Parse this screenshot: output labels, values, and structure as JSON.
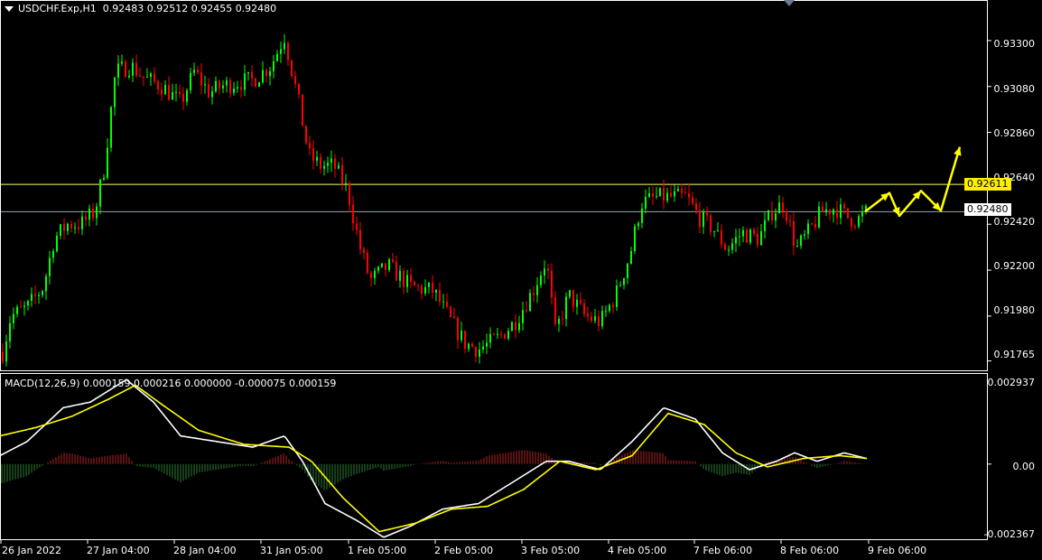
{
  "header": {
    "symbol": "USDCHF.Exp,H1",
    "ohlc": "0.92483 0.92512 0.92455 0.92480"
  },
  "price_axis": {
    "labels": [
      "0.93300",
      "0.93080",
      "0.92860",
      "0.92640",
      "0.92420",
      "0.92200",
      "0.91980",
      "0.91765"
    ]
  },
  "price_boxes": {
    "horizontal_level": "0.92611",
    "current_price": "0.92480"
  },
  "macd": {
    "title": "MACD(12,26,9) 0.000159 0.000216 0.000000 -0.000075 0.000159",
    "axis_labels": [
      "0.002937",
      "0.00",
      "-0.002367"
    ]
  },
  "time_axis": {
    "labels": [
      "26 Jan 2022",
      "27 Jan 04:00",
      "28 Jan 04:00",
      "31 Jan 05:00",
      "1 Feb 05:00",
      "2 Feb 05:00",
      "3 Feb 05:00",
      "4 Feb 05:00",
      "7 Feb 06:00",
      "8 Feb 06:00",
      "9 Feb 06:00"
    ]
  },
  "colors": {
    "background": "#000000",
    "bull_candle": "#00ff00",
    "bear_candle": "#ff0000",
    "macd_line": "#ffffff",
    "signal_line": "#ffff00",
    "hist_positive": "#b22222",
    "hist_negative": "#2e7d32",
    "level_line": "#ffff66",
    "current_line": "#9aa3b5",
    "arrow": "#ffff00"
  },
  "chart_data": {
    "type": "candlestick",
    "ylim": [
      0.9172,
      0.9349
    ],
    "horizontal_line": 0.92611,
    "current_price": 0.9248,
    "price_path": [
      {
        "x": 0,
        "y": 0.9175
      },
      {
        "x": 12,
        "y": 0.9198
      },
      {
        "x": 30,
        "y": 0.9202
      },
      {
        "x": 48,
        "y": 0.9212
      },
      {
        "x": 60,
        "y": 0.9235
      },
      {
        "x": 75,
        "y": 0.9242
      },
      {
        "x": 90,
        "y": 0.9242
      },
      {
        "x": 105,
        "y": 0.9248
      },
      {
        "x": 115,
        "y": 0.9268
      },
      {
        "x": 128,
        "y": 0.9315
      },
      {
        "x": 145,
        "y": 0.9318
      },
      {
        "x": 160,
        "y": 0.9312
      },
      {
        "x": 180,
        "y": 0.9308
      },
      {
        "x": 200,
        "y": 0.93
      },
      {
        "x": 215,
        "y": 0.9315
      },
      {
        "x": 232,
        "y": 0.9305
      },
      {
        "x": 245,
        "y": 0.9308
      },
      {
        "x": 262,
        "y": 0.931
      },
      {
        "x": 280,
        "y": 0.9311
      },
      {
        "x": 300,
        "y": 0.9318
      },
      {
        "x": 315,
        "y": 0.9332
      },
      {
        "x": 330,
        "y": 0.9302
      },
      {
        "x": 342,
        "y": 0.9275
      },
      {
        "x": 355,
        "y": 0.927
      },
      {
        "x": 370,
        "y": 0.927
      },
      {
        "x": 385,
        "y": 0.9258
      },
      {
        "x": 398,
        "y": 0.9232
      },
      {
        "x": 410,
        "y": 0.9215
      },
      {
        "x": 430,
        "y": 0.9222
      },
      {
        "x": 455,
        "y": 0.9212
      },
      {
        "x": 480,
        "y": 0.921
      },
      {
        "x": 500,
        "y": 0.9195
      },
      {
        "x": 515,
        "y": 0.9185
      },
      {
        "x": 530,
        "y": 0.9182
      },
      {
        "x": 550,
        "y": 0.9187
      },
      {
        "x": 570,
        "y": 0.9195
      },
      {
        "x": 590,
        "y": 0.921
      },
      {
        "x": 605,
        "y": 0.9225
      },
      {
        "x": 615,
        "y": 0.919
      },
      {
        "x": 630,
        "y": 0.9208
      },
      {
        "x": 648,
        "y": 0.9198
      },
      {
        "x": 665,
        "y": 0.9195
      },
      {
        "x": 682,
        "y": 0.9208
      },
      {
        "x": 698,
        "y": 0.9228
      },
      {
        "x": 710,
        "y": 0.9252
      },
      {
        "x": 728,
        "y": 0.9255
      },
      {
        "x": 745,
        "y": 0.9255
      },
      {
        "x": 760,
        "y": 0.9255
      },
      {
        "x": 775,
        "y": 0.9245
      },
      {
        "x": 790,
        "y": 0.924
      },
      {
        "x": 805,
        "y": 0.923
      },
      {
        "x": 822,
        "y": 0.9238
      },
      {
        "x": 840,
        "y": 0.9235
      },
      {
        "x": 855,
        "y": 0.9248
      },
      {
        "x": 868,
        "y": 0.9252
      },
      {
        "x": 882,
        "y": 0.923
      },
      {
        "x": 895,
        "y": 0.9238
      },
      {
        "x": 910,
        "y": 0.9248
      },
      {
        "x": 925,
        "y": 0.925
      },
      {
        "x": 940,
        "y": 0.9245
      },
      {
        "x": 950,
        "y": 0.9244
      },
      {
        "x": 960,
        "y": 0.9248
      }
    ],
    "arrows_path": [
      {
        "x": 958,
        "y": 0.9248
      },
      {
        "x": 985,
        "y": 0.9257
      },
      {
        "x": 996,
        "y": 0.9246
      },
      {
        "x": 1020,
        "y": 0.9258
      },
      {
        "x": 1042,
        "y": 0.92485
      },
      {
        "x": 1063,
        "y": 0.9279
      }
    ],
    "macd_ylim": [
      -0.0027,
      0.0032
    ],
    "macd_main": [
      {
        "x": 0,
        "y": 0.0003
      },
      {
        "x": 30,
        "y": 0.0008
      },
      {
        "x": 70,
        "y": 0.002
      },
      {
        "x": 100,
        "y": 0.0022
      },
      {
        "x": 140,
        "y": 0.003
      },
      {
        "x": 170,
        "y": 0.0022
      },
      {
        "x": 200,
        "y": 0.001
      },
      {
        "x": 240,
        "y": 0.0008
      },
      {
        "x": 280,
        "y": 0.0006
      },
      {
        "x": 315,
        "y": 0.001
      },
      {
        "x": 335,
        "y": 0.0001
      },
      {
        "x": 360,
        "y": -0.0014
      },
      {
        "x": 395,
        "y": -0.002
      },
      {
        "x": 425,
        "y": -0.0026
      },
      {
        "x": 455,
        "y": -0.0022
      },
      {
        "x": 490,
        "y": -0.0016
      },
      {
        "x": 530,
        "y": -0.0014
      },
      {
        "x": 570,
        "y": -0.0006
      },
      {
        "x": 605,
        "y": 0.0001
      },
      {
        "x": 630,
        "y": 0.0001
      },
      {
        "x": 665,
        "y": -0.0002
      },
      {
        "x": 700,
        "y": 0.0008
      },
      {
        "x": 735,
        "y": 0.002
      },
      {
        "x": 770,
        "y": 0.0016
      },
      {
        "x": 800,
        "y": 0.0004
      },
      {
        "x": 830,
        "y": -0.0002
      },
      {
        "x": 860,
        "y": 0.0001
      },
      {
        "x": 880,
        "y": 0.0004
      },
      {
        "x": 905,
        "y": 0.0001
      },
      {
        "x": 935,
        "y": 0.0004
      },
      {
        "x": 960,
        "y": 0.0002
      }
    ],
    "macd_signal": [
      {
        "x": 0,
        "y": 0.001
      },
      {
        "x": 40,
        "y": 0.0013
      },
      {
        "x": 80,
        "y": 0.0017
      },
      {
        "x": 120,
        "y": 0.0023
      },
      {
        "x": 150,
        "y": 0.0028
      },
      {
        "x": 180,
        "y": 0.0021
      },
      {
        "x": 220,
        "y": 0.0012
      },
      {
        "x": 270,
        "y": 0.0007
      },
      {
        "x": 320,
        "y": 0.0006
      },
      {
        "x": 345,
        "y": 0.0001
      },
      {
        "x": 380,
        "y": -0.0012
      },
      {
        "x": 420,
        "y": -0.0024
      },
      {
        "x": 460,
        "y": -0.0021
      },
      {
        "x": 500,
        "y": -0.0016
      },
      {
        "x": 540,
        "y": -0.0015
      },
      {
        "x": 580,
        "y": -0.0009
      },
      {
        "x": 620,
        "y": 0.0001
      },
      {
        "x": 660,
        "y": -0.0002
      },
      {
        "x": 700,
        "y": 0.0003
      },
      {
        "x": 740,
        "y": 0.0018
      },
      {
        "x": 780,
        "y": 0.0014
      },
      {
        "x": 815,
        "y": 0.0004
      },
      {
        "x": 850,
        "y": -0.0001
      },
      {
        "x": 890,
        "y": 0.0002
      },
      {
        "x": 930,
        "y": 0.0003
      },
      {
        "x": 960,
        "y": 0.0002
      }
    ]
  }
}
